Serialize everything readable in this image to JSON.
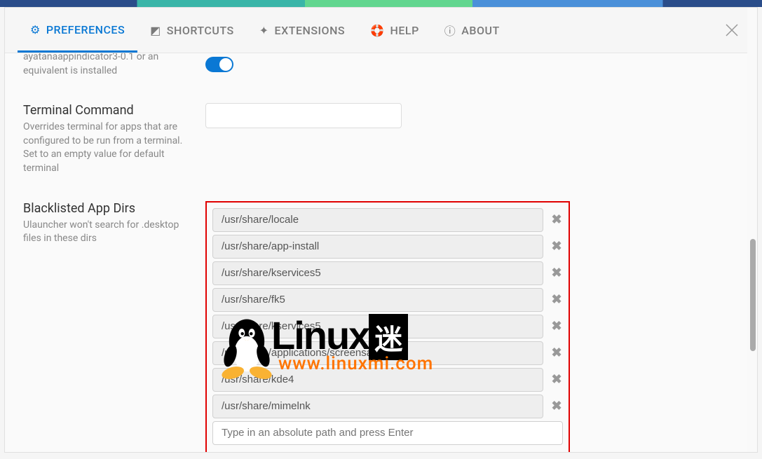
{
  "tabs": {
    "preferences": "PREFERENCES",
    "shortcuts": "SHORTCUTS",
    "extensions": "EXTENSIONS",
    "help": "HELP",
    "about": "ABOUT"
  },
  "partial_setting": {
    "desc": "ayatanaappindicator3-0.1 or an equivalent is installed"
  },
  "terminal": {
    "title": "Terminal Command",
    "desc": "Overrides terminal for apps that are configured to be run from a terminal. Set to an empty value for default terminal",
    "value": ""
  },
  "blacklist": {
    "title": "Blacklisted App Dirs",
    "desc": "Ulauncher won't search for .desktop files in these dirs",
    "dirs": [
      "/usr/share/locale",
      "/usr/share/app-install",
      "/usr/share/kservices5",
      "/usr/share/fk5",
      "/usr/share/kservices5",
      "/usr/share/applications/screensavers",
      "/usr/share/kde4",
      "/usr/share/mimelnk"
    ],
    "placeholder": "Type in an absolute path and press Enter"
  },
  "watermark": {
    "brand": "Linux",
    "suffix": "迷",
    "url": "www.linuxmi.com"
  }
}
